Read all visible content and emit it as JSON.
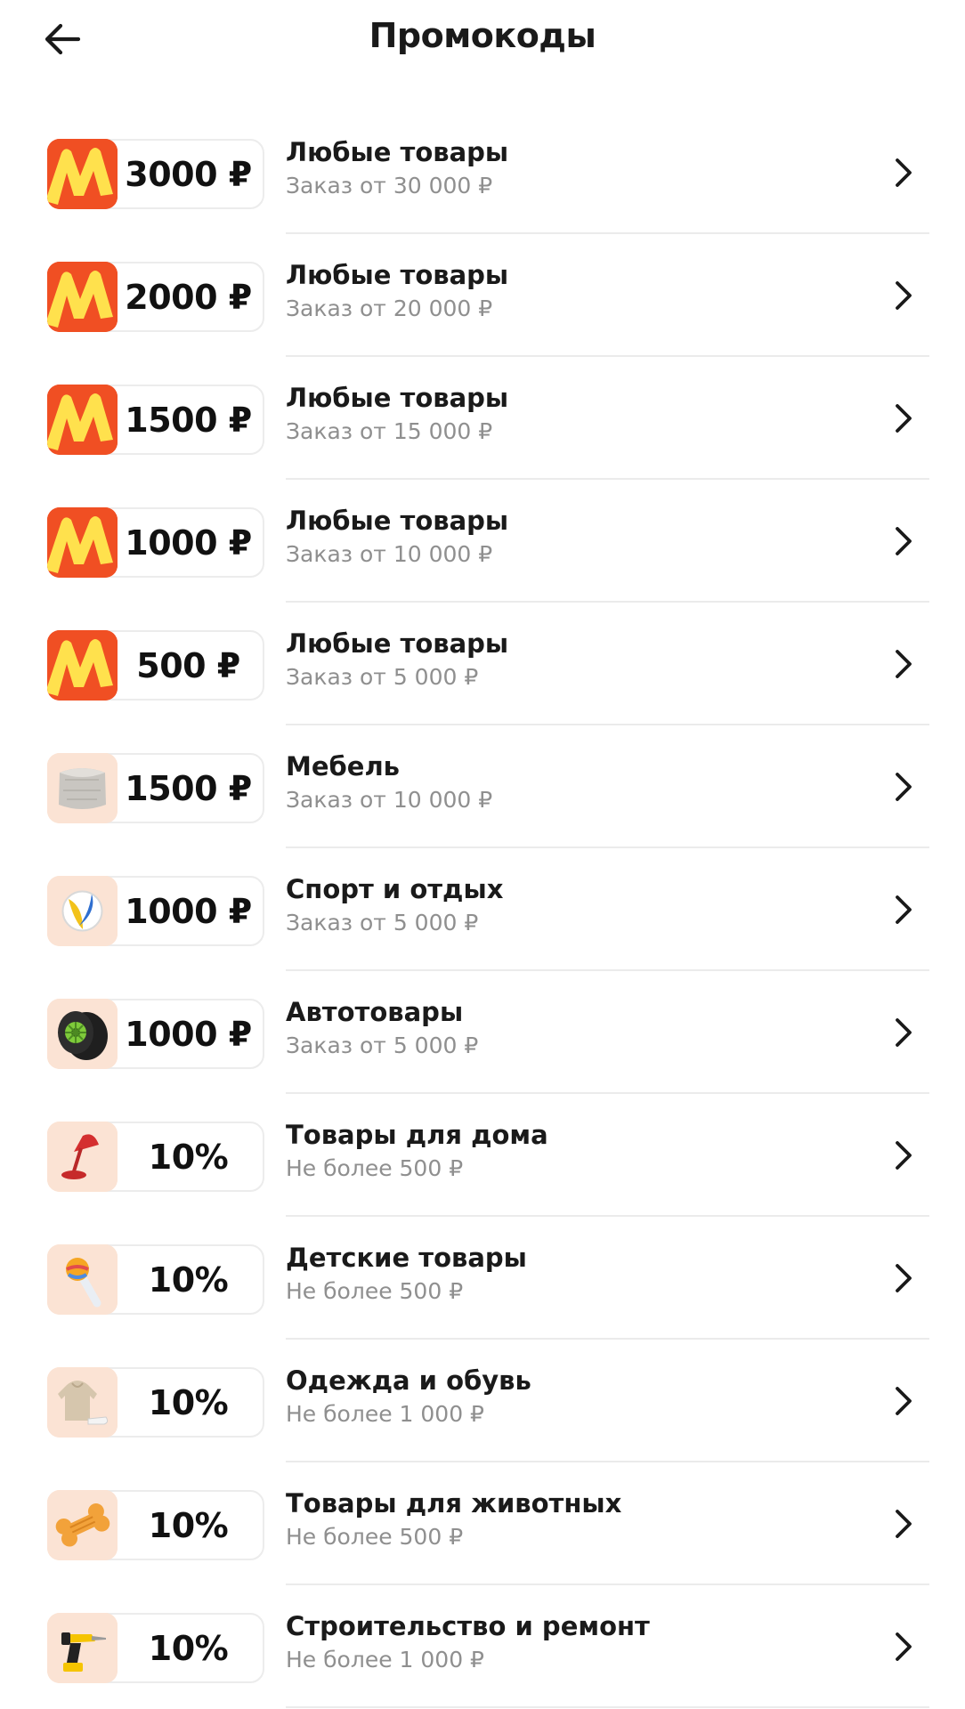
{
  "header": {
    "title": "Промокоды",
    "back_icon": "arrow-left-icon"
  },
  "colors": {
    "brand_red": "#f04f23",
    "brand_yellow": "#ffe14d",
    "category_bg": "#fbe3d4",
    "subtitle_gray": "#8f8f8f",
    "divider": "#ebebeb"
  },
  "promos": [
    {
      "thumb": "market-logo-icon",
      "amount": "3000 ₽",
      "title": "Любые товары",
      "subtitle": "Заказ от 30 000 ₽"
    },
    {
      "thumb": "market-logo-icon",
      "amount": "2000 ₽",
      "title": "Любые товары",
      "subtitle": "Заказ от 20 000 ₽"
    },
    {
      "thumb": "market-logo-icon",
      "amount": "1500 ₽",
      "title": "Любые товары",
      "subtitle": "Заказ от 15 000 ₽"
    },
    {
      "thumb": "market-logo-icon",
      "amount": "1000 ₽",
      "title": "Любые товары",
      "subtitle": "Заказ от 10 000 ₽"
    },
    {
      "thumb": "market-logo-icon",
      "amount": "500 ₽",
      "title": "Любые товары",
      "subtitle": "Заказ от 5 000 ₽"
    },
    {
      "thumb": "pouf-icon",
      "amount": "1500 ₽",
      "title": "Мебель",
      "subtitle": "Заказ от 10 000 ₽"
    },
    {
      "thumb": "volleyball-icon",
      "amount": "1000 ₽",
      "title": "Спорт и отдых",
      "subtitle": "Заказ от 5 000 ₽"
    },
    {
      "thumb": "tire-icon",
      "amount": "1000 ₽",
      "title": "Автотовары",
      "subtitle": "Заказ от 5 000 ₽"
    },
    {
      "thumb": "desk-lamp-icon",
      "amount": "10%",
      "title": "Товары для дома",
      "subtitle": "Не более 500 ₽"
    },
    {
      "thumb": "baby-rattle-icon",
      "amount": "10%",
      "title": "Детские товары",
      "subtitle": "Не более 500 ₽"
    },
    {
      "thumb": "hoodie-sneakers-icon",
      "amount": "10%",
      "title": "Одежда и обувь",
      "subtitle": "Не более 1 000 ₽"
    },
    {
      "thumb": "dog-bone-toy-icon",
      "amount": "10%",
      "title": "Товары для животных",
      "subtitle": "Не более 500 ₽"
    },
    {
      "thumb": "drill-icon",
      "amount": "10%",
      "title": "Строительство и ремонт",
      "subtitle": "Не более 1 000 ₽"
    }
  ]
}
